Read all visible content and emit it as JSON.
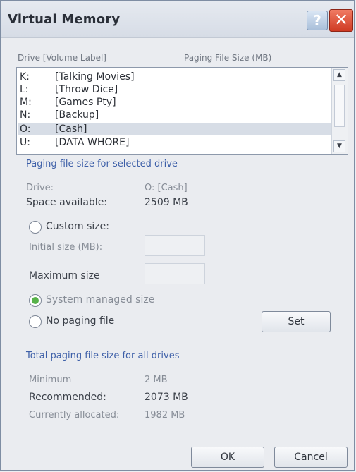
{
  "window": {
    "title": "Virtual Memory",
    "help_glyph": "?",
    "close_glyph": "✕"
  },
  "list": {
    "headers": {
      "drive_label": "Drive [Volume Label]",
      "paging_size": "Paging File Size (MB)"
    },
    "rows": [
      {
        "drive": "K:",
        "label": "[Talking Movies]"
      },
      {
        "drive": "L:",
        "label": "[Throw Dice]"
      },
      {
        "drive": "M:",
        "label": "[Games Pty]"
      },
      {
        "drive": "N:",
        "label": "[Backup]"
      },
      {
        "drive": "O:",
        "label": "[Cash]"
      },
      {
        "drive": "U:",
        "label": "[DATA WHORE]"
      }
    ],
    "selected_index": 4,
    "scroll_up_glyph": "▲",
    "scroll_down_glyph": "▼"
  },
  "selected_drive": {
    "section_title": "Paging file size for selected drive",
    "drive_label": "Drive:",
    "drive_value": "O: [Cash]",
    "space_label": "Space available:",
    "space_value": "2509 MB",
    "custom_size_label": "Custom size:",
    "initial_size_label": "Initial size (MB):",
    "maximum_size_label": "Maximum size",
    "system_managed_label": "System managed size",
    "no_paging_label": "No paging file",
    "set_button": "Set"
  },
  "totals": {
    "section_title": "Total paging file size for all drives",
    "minimum_label": "Minimum",
    "minimum_value": "2 MB",
    "recommended_label": "Recommended:",
    "recommended_value": "2073 MB",
    "allocated_label": "Currently allocated:",
    "allocated_value": "1982 MB"
  },
  "buttons": {
    "ok": "OK",
    "cancel": "Cancel"
  }
}
